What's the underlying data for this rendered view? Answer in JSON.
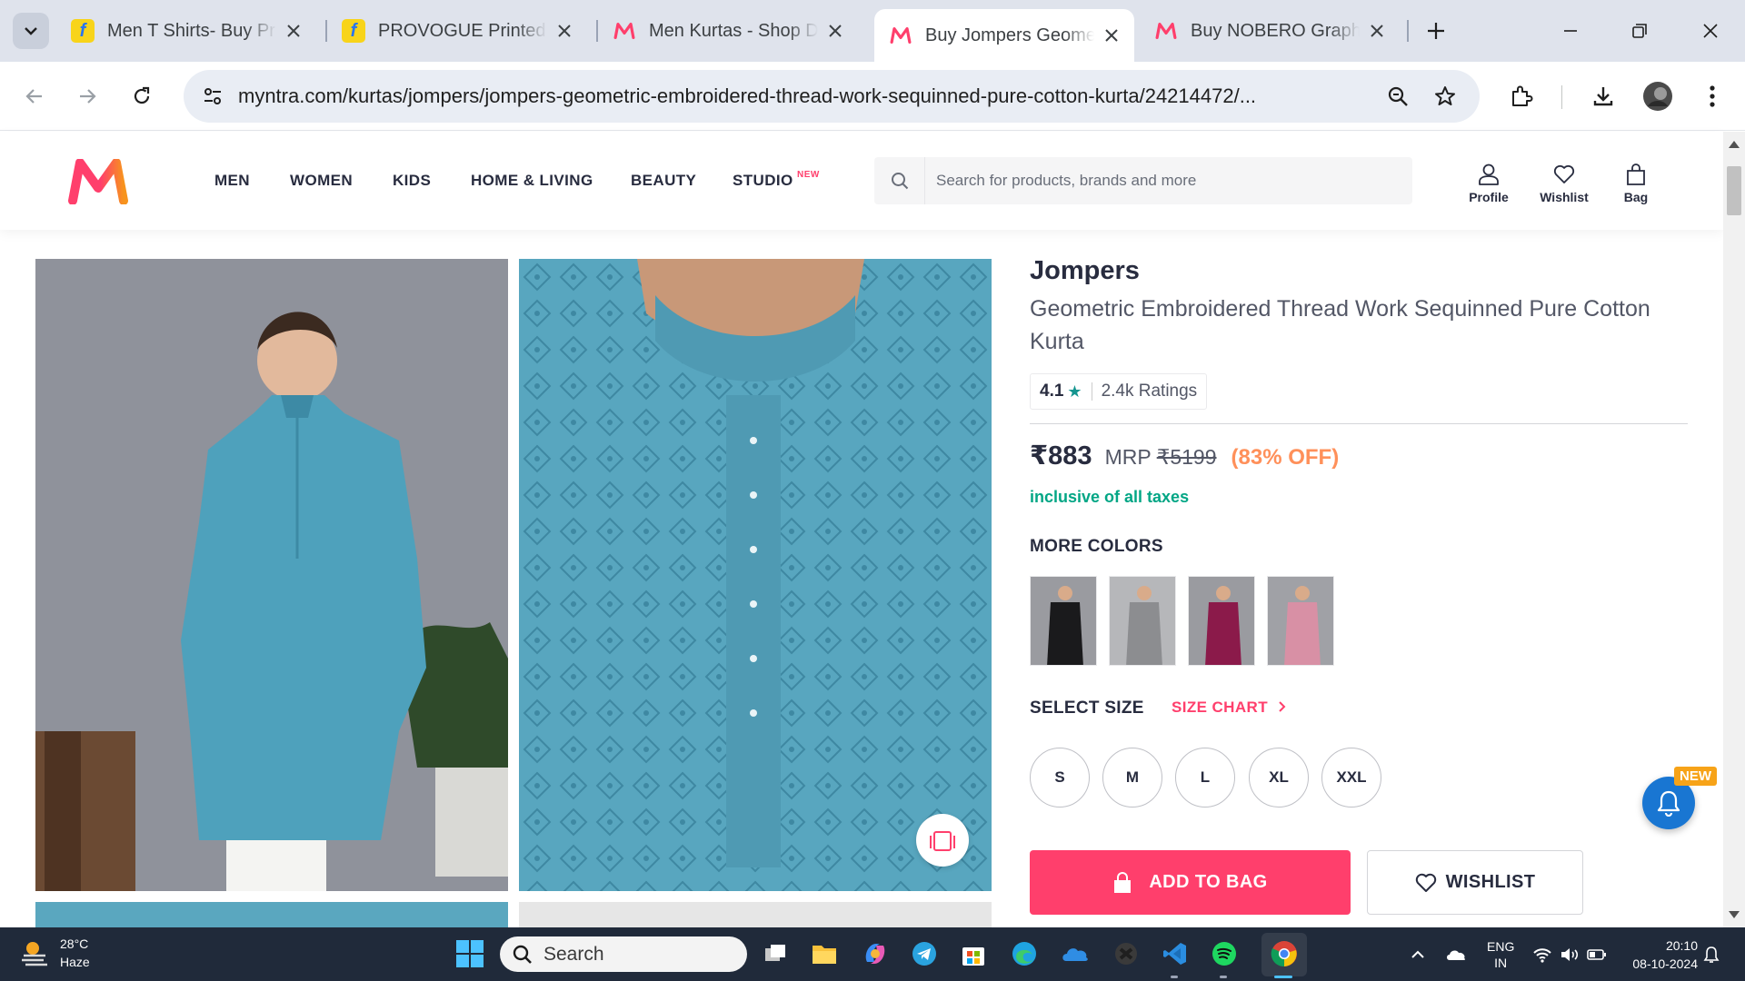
{
  "browser": {
    "tabs": [
      {
        "title": "Men T Shirts- Buy Pr",
        "favicon": "flipkart"
      },
      {
        "title": "PROVOGUE Printed",
        "favicon": "flipkart"
      },
      {
        "title": "Men Kurtas - Shop D",
        "favicon": "myntra"
      },
      {
        "title": "Buy Jompers Geome",
        "favicon": "myntra",
        "active": true
      },
      {
        "title": "Buy NOBERO Graph",
        "favicon": "myntra"
      }
    ],
    "url": "myntra.com/kurtas/jompers/jompers-geometric-embroidered-thread-work-sequinned-pure-cotton-kurta/24214472/..."
  },
  "site": {
    "nav": [
      "MEN",
      "WOMEN",
      "KIDS",
      "HOME & LIVING",
      "BEAUTY",
      "STUDIO"
    ],
    "nav_new_badge": "NEW",
    "search_placeholder": "Search for products, brands and more",
    "actions": {
      "profile": "Profile",
      "wishlist": "Wishlist",
      "bag": "Bag"
    },
    "brand_colors": {
      "pink": "#ff3f6c",
      "orange": "#ff905a",
      "green": "#03a685"
    }
  },
  "product": {
    "brand": "Jompers",
    "name": "Geometric Embroidered Thread Work Sequinned Pure Cotton Kurta",
    "rating": "4.1",
    "rating_star": "★",
    "ratings_count": "2.4k Ratings",
    "price": "₹883",
    "mrp_label": "MRP",
    "mrp": "₹5199",
    "discount": "(83% OFF)",
    "tax_note": "inclusive of all taxes",
    "more_colors_label": "MORE COLORS",
    "colors": [
      "black",
      "grey",
      "magenta",
      "pink"
    ],
    "select_size_label": "SELECT SIZE",
    "size_chart_label": "SIZE CHART",
    "sizes": [
      "S",
      "M",
      "L",
      "XL",
      "XXL"
    ],
    "add_to_bag": "ADD TO BAG",
    "wishlist": "WISHLIST"
  },
  "widget": {
    "badge": "NEW"
  },
  "taskbar": {
    "temp": "28°C",
    "weather": "Haze",
    "search": "Search",
    "lang_top": "ENG",
    "lang_bottom": "IN",
    "time": "20:10",
    "date": "08-10-2024"
  }
}
